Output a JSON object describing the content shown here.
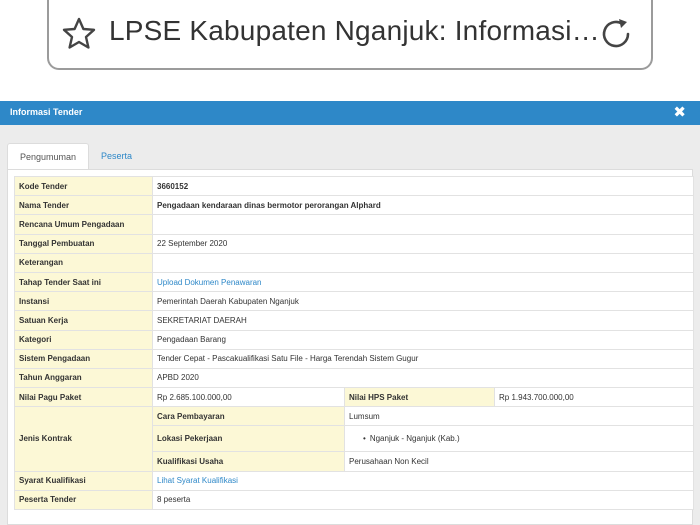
{
  "browser": {
    "title": "LPSE Kabupaten Nganjuk: Informasi…",
    "star_icon": "star-icon",
    "reload_icon": "reload-icon"
  },
  "modal": {
    "title": "Informasi Tender",
    "close": "✖",
    "tabs": [
      {
        "label": "Pengumuman",
        "active": true
      },
      {
        "label": "Peserta",
        "active": false
      }
    ]
  },
  "tender": {
    "kode_label": "Kode Tender",
    "kode_value": "3660152",
    "nama_label": "Nama Tender",
    "nama_value": "Pengadaan kendaraan dinas bermotor perorangan Alphard",
    "rup_label": "Rencana Umum Pengadaan",
    "rup_value": "",
    "tanggal_label": "Tanggal Pembuatan",
    "tanggal_value": "22 September 2020",
    "ket_label": "Keterangan",
    "ket_value": "",
    "tahap_label": "Tahap Tender Saat ini",
    "tahap_value": "Upload Dokumen Penawaran",
    "instansi_label": "Instansi",
    "instansi_value": "Pemerintah Daerah Kabupaten Nganjuk",
    "satker_label": "Satuan Kerja",
    "satker_value": "SEKRETARIAT DAERAH",
    "kategori_label": "Kategori",
    "kategori_value": "Pengadaan Barang",
    "sistem_label": "Sistem Pengadaan",
    "sistem_value": "Tender Cepat - Pascakualifikasi Satu File - Harga Terendah Sistem Gugur",
    "tahun_label": "Tahun Anggaran",
    "tahun_value": "APBD 2020",
    "pagu_label": "Nilai Pagu Paket",
    "pagu_value": "Rp 2.685.100.000,00",
    "hps_label": "Nilai HPS Paket",
    "hps_value": "Rp 1.943.700.000,00",
    "jenis_label": "Jenis Kontrak",
    "cara_label": "Cara Pembayaran",
    "cara_value": "Lumsum",
    "lokasi_label": "Lokasi Pekerjaan",
    "lokasi_value": "Nganjuk - Nganjuk (Kab.)",
    "kualifikasi_usaha_label": "Kualifikasi Usaha",
    "kualifikasi_usaha_value": "Perusahaan Non Kecil",
    "syarat_label": "Syarat Kualifikasi",
    "syarat_value": "Lihat Syarat Kualifikasi",
    "peserta_label": "Peserta Tender",
    "peserta_value": "8 peserta"
  }
}
